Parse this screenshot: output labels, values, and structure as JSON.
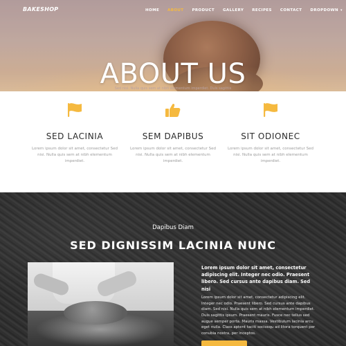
{
  "brand": "BAKESHOP",
  "nav": {
    "items": [
      "HOME",
      "ABOUT",
      "PRODUCT",
      "GALLERY",
      "RECIPES",
      "CONTACT",
      "DROPDOWN"
    ],
    "active": "ABOUT",
    "dropdown_caret": "▾"
  },
  "hero": {
    "title": "ABOUT US",
    "subtitle": "Sed nisi. Nulla quis sem at nibh elementum imperdiet. Duis sagittis"
  },
  "features": [
    {
      "icon": "flag-icon",
      "title": "SED LACINIA",
      "text": "Lorem ipsum dolor sit amet, consectetur Sed nisi. Nulla quis sem at nibh elementum imperdiet."
    },
    {
      "icon": "thumbs-up-icon",
      "title": "SEM DAPIBUS",
      "text": "Lorem ipsum dolor sit amet, consectetur Sed nisi. Nulla quis sem at nibh elementum imperdiet."
    },
    {
      "icon": "flag-icon",
      "title": "SIT ODIONEC",
      "text": "Lorem ipsum dolor sit amet, consectetur Sed nisi. Nulla quis sem at nibh elementum imperdiet."
    }
  ],
  "dark_section": {
    "subtitle": "Dapibus Diam",
    "title": "SED DIGNISSIM LACINIA NUNC",
    "lead": "Lorem ipsum dolor sit amet, consectetur adipiscing elit. Integer nec odio. Praesent libero. Sed cursus ante dapibus diam. Sed nisi",
    "body": "Lorem ipsum dolor sit amet, consectetur adipiscing elit. Integer nec odio. Praesent libero. Sed cursus ante dapibus diam. Sed nisi. Nulla quis sem at nibh elementum imperdiet. Duis sagittis ipsum. Praesent mauris. Fusce nec tellus sed augue semper porta. Mauris massa. Vestibulum lacinia arcu eget nulla. Class aptent taciti sociosqu ad litora torquent per conubia nostra, per inceptos."
  },
  "colors": {
    "accent": "#f5b93f",
    "dark_bg": "#2d2d2d",
    "heading": "#2a2a2a",
    "muted": "#9a9a9a"
  }
}
